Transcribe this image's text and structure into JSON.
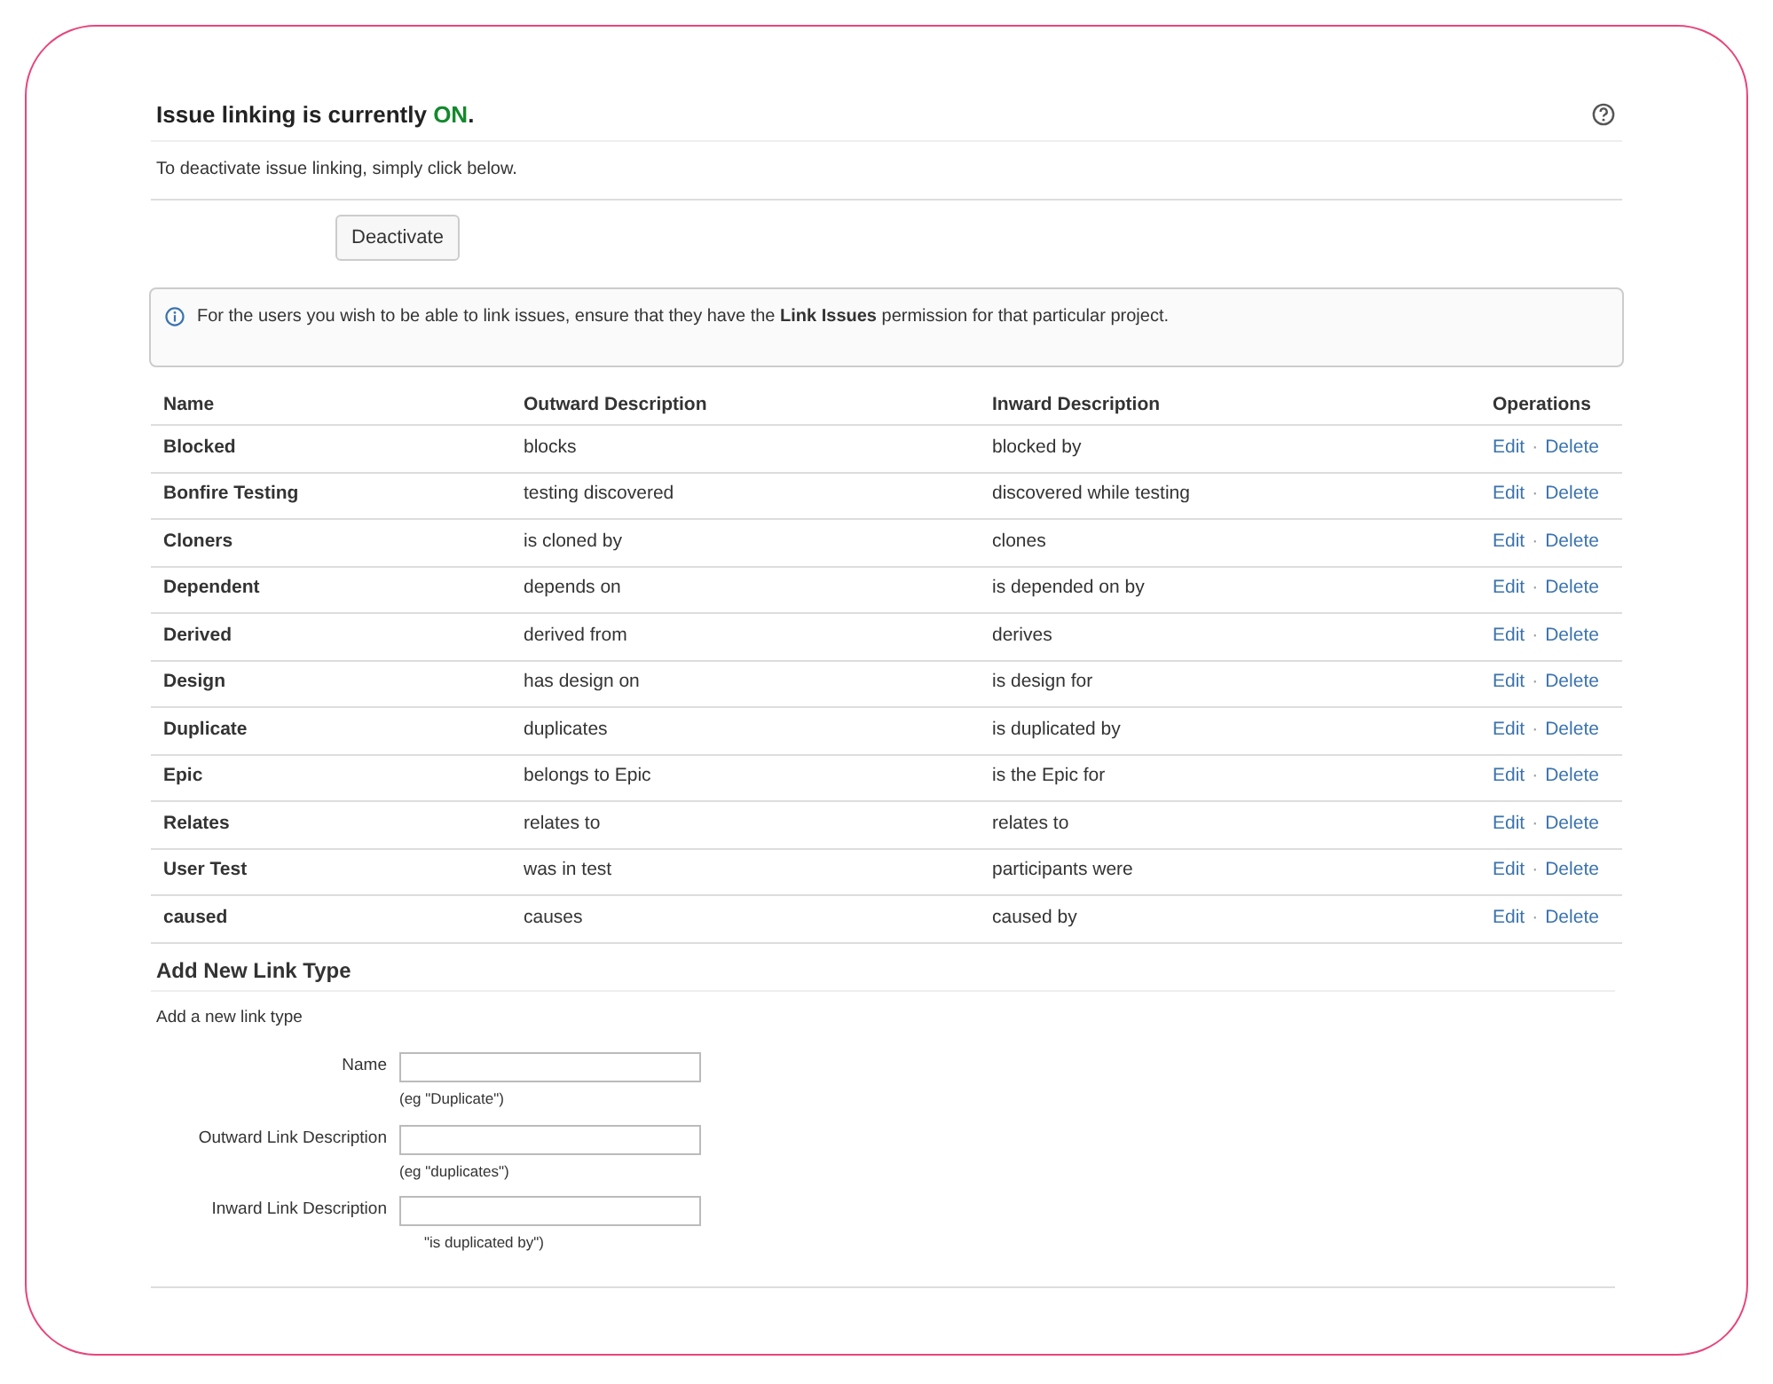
{
  "header": {
    "title_prefix": "Issue linking is currently ",
    "status": "ON",
    "title_suffix": ".",
    "on": true,
    "description": "To deactivate issue linking, simply click below.",
    "button": "Deactivate"
  },
  "info": {
    "message": "For the users you wish to be able to link issues, ensure that they have the **Link Issues** permission for that particular project."
  },
  "table": {
    "columns": [
      "Name",
      "Outward Description",
      "Inward Description",
      "Operations"
    ],
    "rows": [
      {
        "name": "Blocked",
        "outward": "blocks",
        "inward": "blocked by",
        "edit": "Edit",
        "separator": "·",
        "delete": "Delete"
      },
      {
        "name": "Bonfire Testing",
        "outward": "testing discovered",
        "inward": "discovered while testing",
        "edit": "Edit",
        "separator": "·",
        "delete": "Delete"
      },
      {
        "name": "Cloners",
        "outward": "is cloned by",
        "inward": "clones",
        "edit": "Edit",
        "separator": "·",
        "delete": "Delete"
      },
      {
        "name": "Dependent",
        "outward": "depends on",
        "inward": "is depended on by",
        "edit": "Edit",
        "separator": "·",
        "delete": "Delete"
      },
      {
        "name": "Derived",
        "outward": "derived from",
        "inward": "derives",
        "edit": "Edit",
        "separator": "·",
        "delete": "Delete"
      },
      {
        "name": "Design",
        "outward": "has design on",
        "inward": "is design for",
        "edit": "Edit",
        "separator": "·",
        "delete": "Delete"
      },
      {
        "name": "Duplicate",
        "outward": "duplicates",
        "inward": "is duplicated by",
        "edit": "Edit",
        "separator": "·",
        "delete": "Delete"
      },
      {
        "name": "Epic",
        "outward": "belongs to Epic",
        "inward": "is the Epic for",
        "edit": "Edit",
        "separator": "·",
        "delete": "Delete"
      },
      {
        "name": "Relates",
        "outward": "relates to",
        "inward": "relates to",
        "edit": "Edit",
        "separator": "·",
        "delete": "Delete"
      },
      {
        "name": "User Test",
        "outward": "was in test",
        "inward": "participants were",
        "edit": "Edit",
        "separator": "·",
        "delete": "Delete"
      },
      {
        "name": "caused",
        "outward": "causes",
        "inward": "caused by",
        "edit": "Edit",
        "separator": "·",
        "delete": "Delete"
      }
    ]
  },
  "add_form": {
    "title": "Add New Link Type",
    "description": "Add a new link type",
    "fields": [
      {
        "label": "Name",
        "hint": "(eg \"Duplicate\")"
      },
      {
        "label": "Outward Link Description",
        "hint": "(eg \"duplicates\")"
      },
      {
        "label": "Inward Link Description",
        "hint": "\"is duplicated by\")"
      }
    ]
  }
}
